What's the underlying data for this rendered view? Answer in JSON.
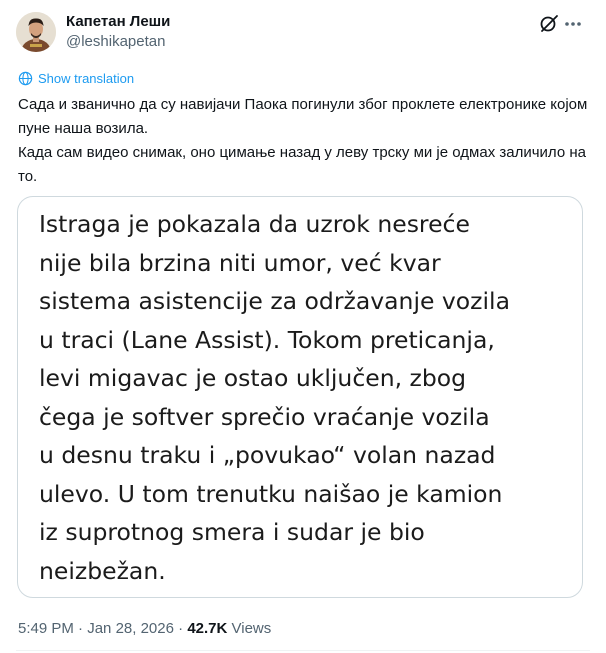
{
  "author": {
    "name": "Капетан Леши",
    "handle": "@leshikapetan"
  },
  "icons": {
    "avatar": "person-avatar",
    "grok": "grok-icon",
    "more": "more-icon",
    "translate": "translate-icon"
  },
  "tweet": {
    "show_translation": "Show translation",
    "paragraphs": [
      "Сада и званично да су навијачи Паока погинули због проклете електронике којом пуне наша возила.",
      "Када сам видео снимак, оно цимање назад у леву трску ми је одмах заличило на то."
    ]
  },
  "media": {
    "lines": [
      "Istraga je pokazala da uzrok nesreće",
      "nije bila brzina niti umor, već kvar",
      "sistema asistencije za održavanje vozila",
      "u traci (Lane Assist). Tokom preticanja,",
      "levi migavac je ostao uključen, zbog",
      "čega je softver sprečio vraćanje vozila",
      "u desnu traku i „povukao“ volan nazad",
      "ulevo. U tom trenutku naišao je kamion",
      "iz suprotnog smera i sudar je bio",
      "neizbežan."
    ]
  },
  "meta": {
    "time": "5:49 PM",
    "sep1": " · ",
    "date": "Jan 28, 2026",
    "sep2": " · ",
    "views_count": "42.7K",
    "views_label": " Views"
  },
  "colors": {
    "link": "#1d9bf0",
    "secondary": "#536471",
    "border": "#cfd9de"
  }
}
